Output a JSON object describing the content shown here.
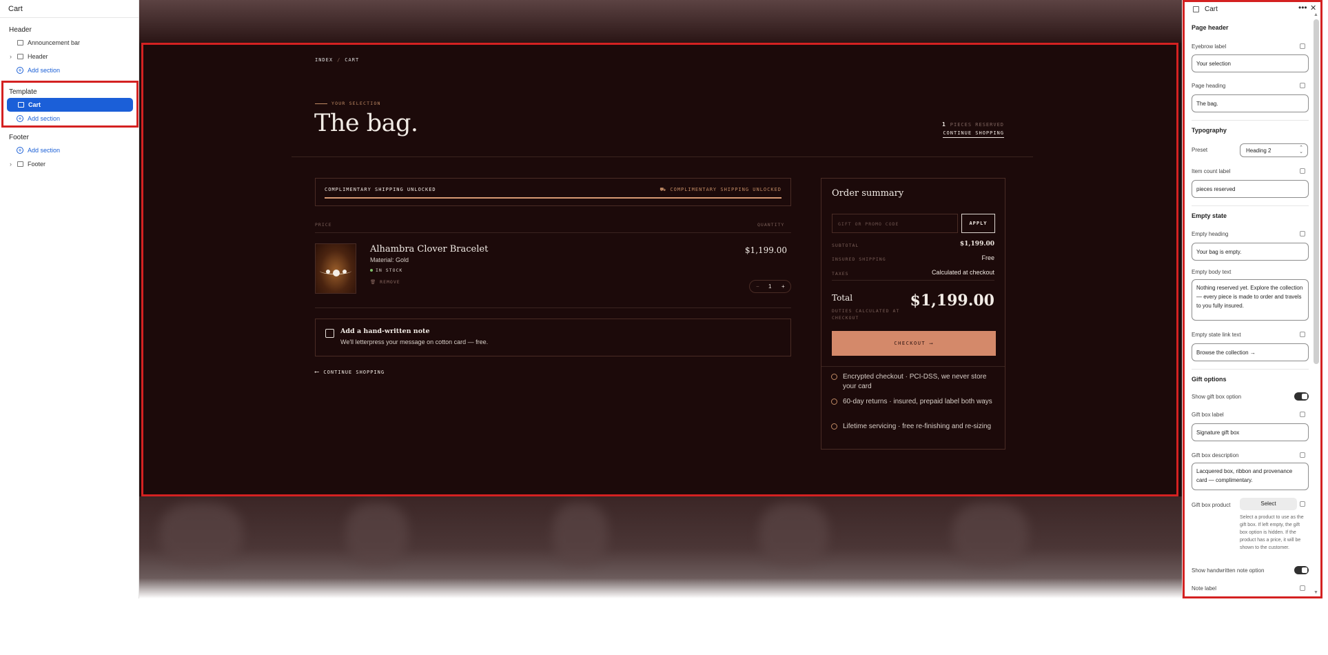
{
  "left_panel": {
    "title": "Cart",
    "header_group": "Header",
    "announcement_bar": "Announcement bar",
    "header_item": "Header",
    "add_section": "Add section",
    "template_group": "Template",
    "cart_item": "Cart",
    "footer_group": "Footer",
    "footer_item": "Footer"
  },
  "preview": {
    "breadcrumb": {
      "index": "INDEX",
      "sep": "/",
      "current": "CART"
    },
    "eyebrow": "YOUR SELECTION",
    "heading": "The bag.",
    "count_number": "1",
    "count_label": "PIECES RESERVED",
    "continue_top": "CONTINUE SHOPPING",
    "shipping_left": "COMPLIMENTARY SHIPPING UNLOCKED",
    "shipping_right": "⛟ COMPLIMENTARY SHIPPING UNLOCKED",
    "shipping_progress": 1.0,
    "col_price": "PRICE",
    "col_quantity": "QUANTITY",
    "item": {
      "name": "Alhambra Clover Bracelet",
      "material": "Material: Gold",
      "stock": "IN STOCK",
      "remove": "REMOVE",
      "price": "$1,199.00",
      "qty": "1",
      "minus": "−",
      "plus": "+"
    },
    "note_title": "Add a hand-written note",
    "note_desc": "We'll letterpress your message on cotton card — free.",
    "continue_bottom": "CONTINUE SHOPPING",
    "continue_arrow": "⟵",
    "summary": {
      "heading": "Order summary",
      "promo_placeholder": "GIFT OR PROMO CODE",
      "apply": "APPLY",
      "subtotal_label": "SUBTOTAL",
      "subtotal_value": "$1,199.00",
      "shipping_label": "INSURED SHIPPING",
      "shipping_value": "Free",
      "taxes_label": "TAXES",
      "taxes_value": "Calculated at checkout",
      "total_label": "Total",
      "total_sub": "DUTIES CALCULATED AT CHECKOUT",
      "total_value": "$1,199.00",
      "checkout": "CHECKOUT  ⟶",
      "trust": [
        "Encrypted checkout · PCI-DSS, we never store your card",
        "60-day returns · insured, prepaid label both ways",
        "Lifetime servicing · free re-finishing and re-sizing"
      ]
    }
  },
  "right_panel": {
    "title": "Cart",
    "dots": "•••",
    "close": "✕",
    "page_header": "Page header",
    "eyebrow_label": "Eyebrow label",
    "eyebrow_value": "Your selection",
    "page_heading_label": "Page heading",
    "page_heading_value": "The bag.",
    "typography": "Typography",
    "preset_label": "Preset",
    "preset_value": "Heading 2",
    "item_count_label": "Item count label",
    "item_count_value": "pieces reserved",
    "empty_state": "Empty state",
    "empty_heading_label": "Empty heading",
    "empty_heading_value": "Your bag is empty.",
    "empty_body_label": "Empty body text",
    "empty_body_value": "Nothing reserved yet. Explore the collection — every piece is made to order and travels to you fully insured.",
    "empty_link_label": "Empty state link text",
    "empty_link_value": "Browse the collection →",
    "gift_options": "Gift options",
    "show_gift_box": "Show gift box option",
    "gift_box_label": "Gift box label",
    "gift_box_label_value": "Signature gift box",
    "gift_box_desc_label": "Gift box description",
    "gift_box_desc_value": "Lacquered box, ribbon and provenance card — complimentary.",
    "gift_box_product": "Gift box product",
    "select": "Select",
    "help": "Select a product to use as the gift box. If left empty, the gift box option is hidden. If the product has a price, it will be shown to the customer.",
    "show_note": "Show handwritten note option",
    "note_label": "Note label"
  }
}
